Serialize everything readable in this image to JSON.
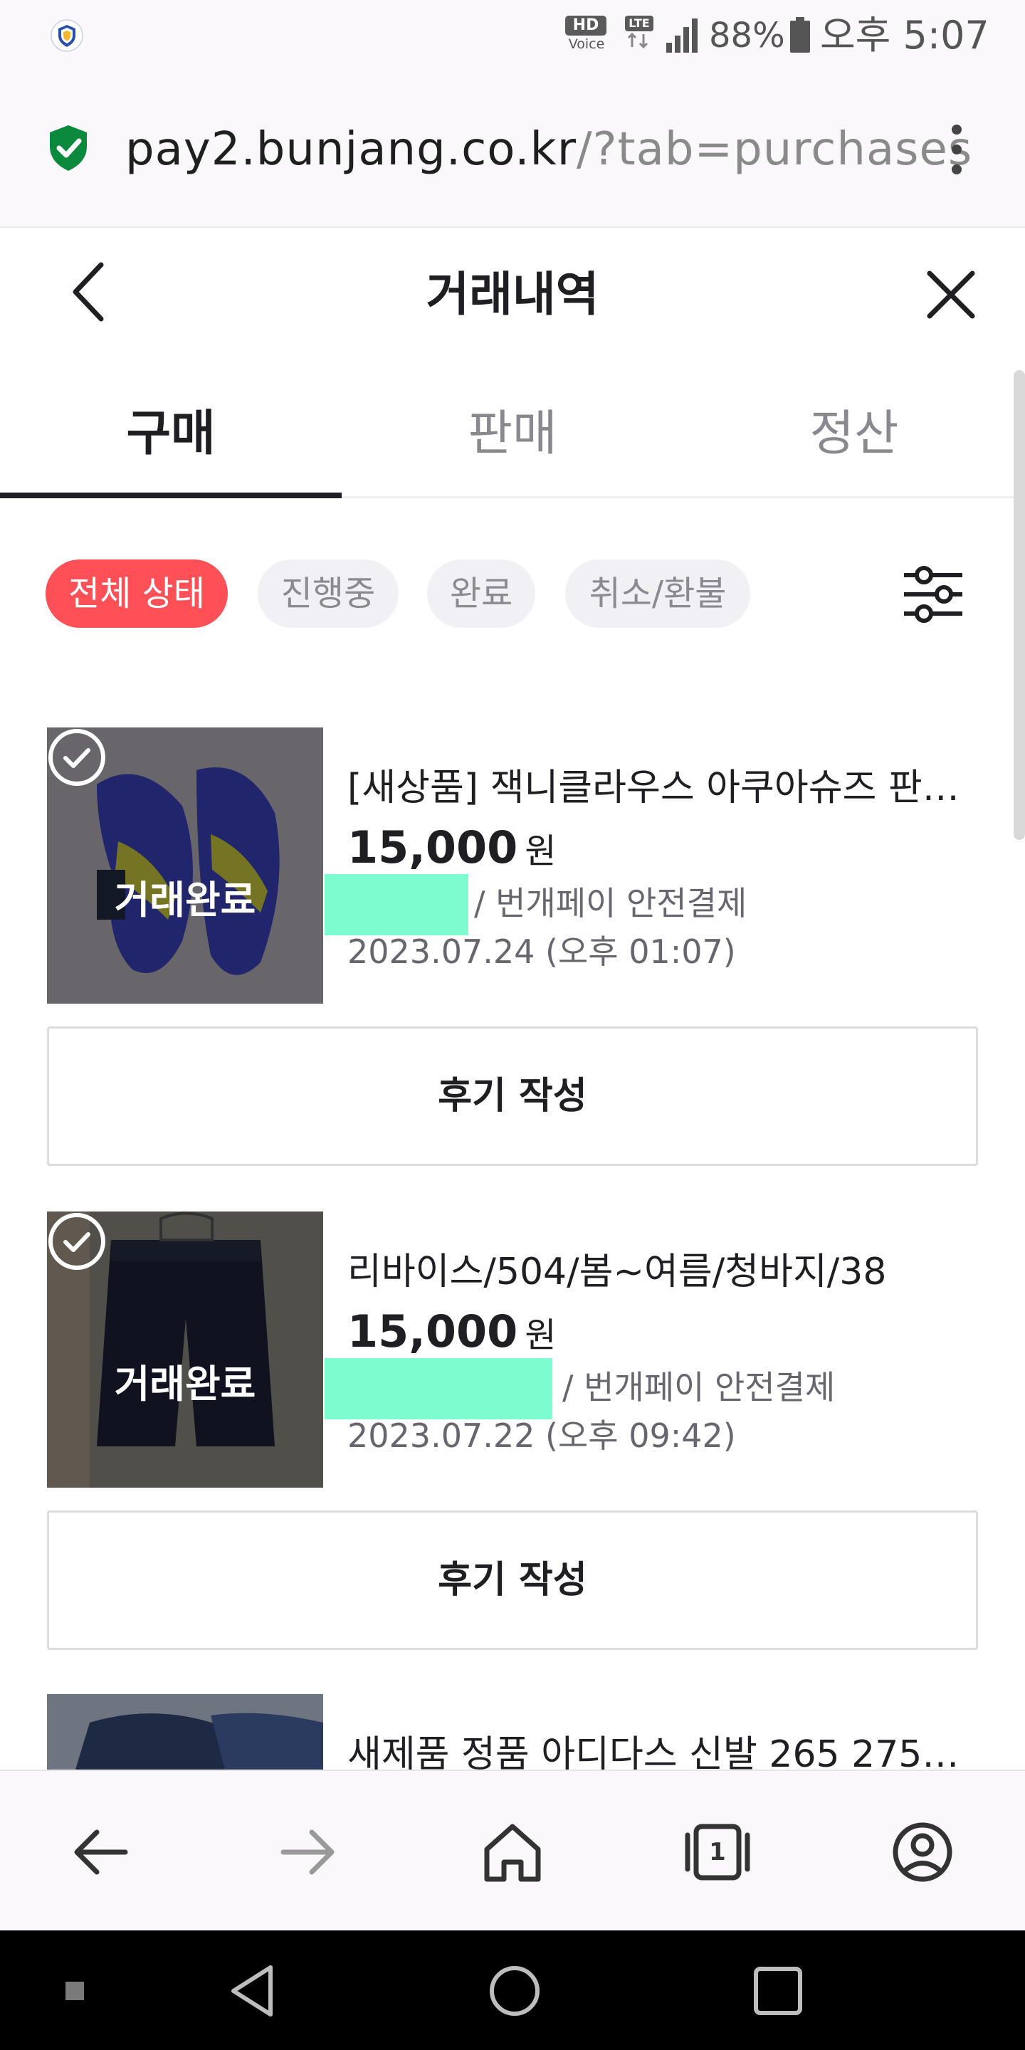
{
  "status_bar": {
    "hd": "HD",
    "voice": "Voice",
    "network": "LTE",
    "battery": "88%",
    "time": "오후 5:07"
  },
  "browser": {
    "url_domain": "pay2.bunjang.co.kr",
    "url_path": "/?tab=purchases"
  },
  "header": {
    "title": "거래내역"
  },
  "tabs": [
    {
      "label": "구매",
      "active": true
    },
    {
      "label": "판매",
      "active": false
    },
    {
      "label": "정산",
      "active": false
    }
  ],
  "filters": [
    {
      "label": "전체 상태",
      "active": true
    },
    {
      "label": "진행중",
      "active": false
    },
    {
      "label": "완료",
      "active": false
    },
    {
      "label": "취소/환불",
      "active": false
    }
  ],
  "items": [
    {
      "title": "[새상품] 잭니클라우스 아쿠아슈즈 판매합니다",
      "price": "15,000",
      "unit": "원",
      "status": "거래완료",
      "payment": "/ 번개페이 안전결제",
      "date": "2023.07.24 (오후 01:07)",
      "review_button": "후기 작성"
    },
    {
      "title": "리바이스/504/봄~여름/청바지/38",
      "price": "15,000",
      "unit": "원",
      "status": "거래완료",
      "payment": "/ 번개페이 안전결제",
      "date": "2023.07.22 (오후 09:42)",
      "review_button": "후기 작성"
    },
    {
      "title": "새제품 정품 아디다스 신발 265 275 ..."
    }
  ],
  "colors": {
    "accent": "#ff5058",
    "redaction": "#7dfcd0",
    "shield": "#0b8a3e"
  },
  "bottom_bar": {
    "tab_count": "1"
  }
}
